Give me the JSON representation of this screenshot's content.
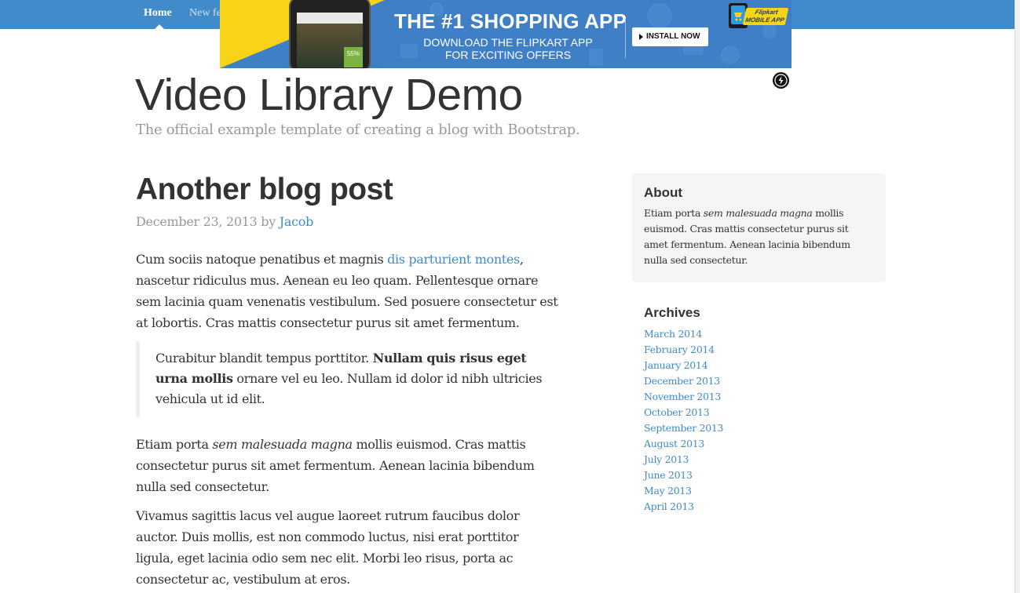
{
  "nav": {
    "items": [
      {
        "label": "Home"
      },
      {
        "label": "New fe"
      }
    ]
  },
  "ad": {
    "headline": "THE #1 SHOPPING APP",
    "line1": "DOWNLOAD THE FLIPKART APP",
    "line2": "FOR EXCITING OFFERS",
    "button": "INSTALL NOW",
    "logo_text": "Flipkart MOBILE APP",
    "phone_badge": "55%",
    "colors": {
      "blue": "#3f7fc5",
      "yellow": "#f7d417"
    }
  },
  "blog": {
    "title": "Video Library Demo",
    "description": "The official example template of creating a blog with Bootstrap."
  },
  "post": {
    "title": "Another blog post",
    "date": "December 23, 2013",
    "by": "by",
    "author": "Jacob",
    "p1_before": "Cum sociis natoque penatibus et magnis ",
    "p1_link": "dis parturient montes",
    "p1_after": ", nascetur ridiculus mus. Aenean eu leo quam. Pellentesque ornare sem lacinia quam venenatis vestibulum. Sed posuere consectetur est at lobortis. Cras mattis consectetur purus sit amet fermentum.",
    "quote_before": "Curabitur blandit tempus porttitor. ",
    "quote_bold": "Nullam quis risus eget urna mollis",
    "quote_after": " ornare vel eu leo. Nullam id dolor id nibh ultricies vehicula ut id elit.",
    "p2_before": "Etiam porta ",
    "p2_italic": "sem malesuada magna",
    "p2_after": " mollis euismod. Cras mattis consectetur purus sit amet fermentum. Aenean lacinia bibendum nulla sed consectetur.",
    "p3": "Vivamus sagittis lacus vel augue laoreet rutrum faucibus dolor auctor. Duis mollis, est non commodo luctus, nisi erat porttitor ligula, eget lacinia odio sem nec elit. Morbi leo risus, porta ac consectetur ac, vestibulum at eros."
  },
  "sidebar": {
    "about": {
      "heading": "About",
      "text_before": "Etiam porta ",
      "text_italic": "sem malesuada magna",
      "text_after": " mollis euismod. Cras mattis consectetur purus sit amet fermentum. Aenean lacinia bibendum nulla sed consectetur."
    },
    "archives": {
      "heading": "Archives",
      "items": [
        "March 2014",
        "February 2014",
        "January 2014",
        "December 2013",
        "November 2013",
        "October 2013",
        "September 2013",
        "August 2013",
        "July 2013",
        "June 2013",
        "May 2013",
        "April 2013"
      ]
    }
  },
  "colors": {
    "navbar": "#428bca",
    "link": "#428bca",
    "muted": "#999999"
  }
}
